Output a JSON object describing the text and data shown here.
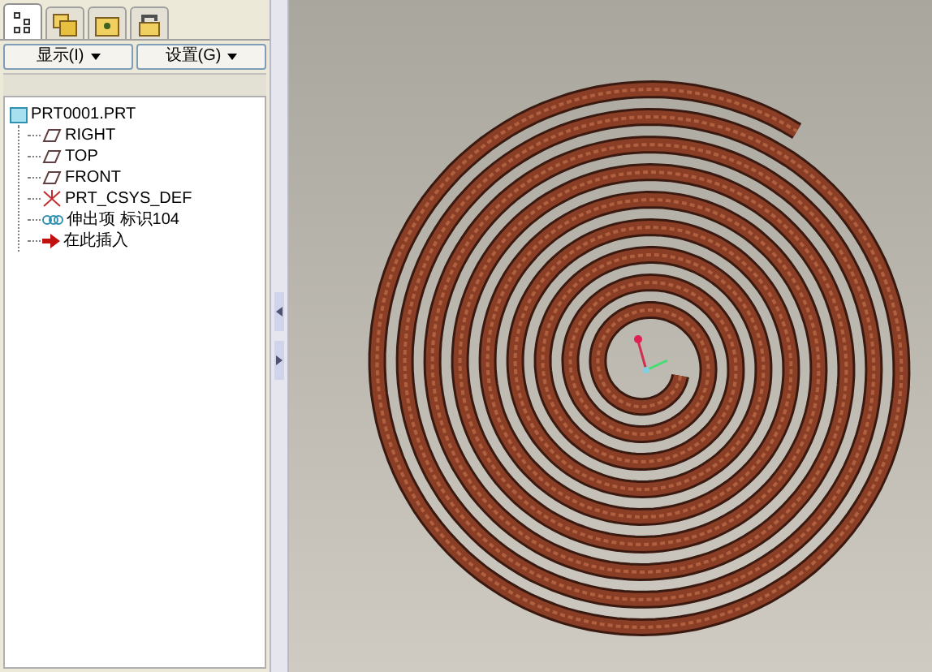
{
  "panel_tabs": [
    {
      "selected": true
    },
    {
      "selected": false
    },
    {
      "selected": false
    },
    {
      "selected": false
    }
  ],
  "buttons": [
    {
      "label": "显示(I)"
    },
    {
      "label": "设置(G)"
    }
  ],
  "model_tree": {
    "label": "PRT0001.PRT",
    "kind": "part",
    "children": [
      {
        "label": "RIGHT",
        "kind": "plane"
      },
      {
        "label": "TOP",
        "kind": "plane"
      },
      {
        "label": "FRONT",
        "kind": "plane"
      },
      {
        "label": "PRT_CSYS_DEF",
        "kind": "csys"
      },
      {
        "label": "伸出项 标识104",
        "kind": "feature"
      },
      {
        "label": "在此插入",
        "kind": "insert"
      }
    ]
  }
}
